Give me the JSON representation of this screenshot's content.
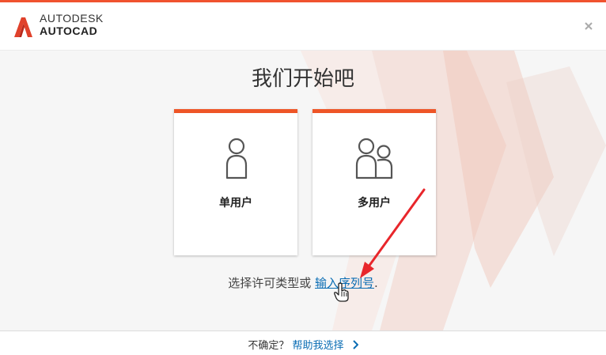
{
  "header": {
    "brand_line1": "AUTODESK",
    "brand_line2": "AUTOCAD",
    "brand_logo_icon": "autodesk-a-logo-icon",
    "close_icon": "close-icon"
  },
  "main": {
    "title": "我们开始吧",
    "cards": [
      {
        "label": "单用户",
        "icon": "single-user-icon"
      },
      {
        "label": "多用户",
        "icon": "multi-user-icon"
      }
    ],
    "license_prompt": "选择许可类型或",
    "serial_link": "输入序列号",
    "trailing_period": "."
  },
  "footer": {
    "question": "不确定？",
    "help_link": "帮助我选择",
    "chevron_icon": "chevron-right-icon"
  },
  "colors": {
    "accent": "#ee5527",
    "link": "#0a6db4",
    "annotation_arrow": "#e8262b"
  }
}
